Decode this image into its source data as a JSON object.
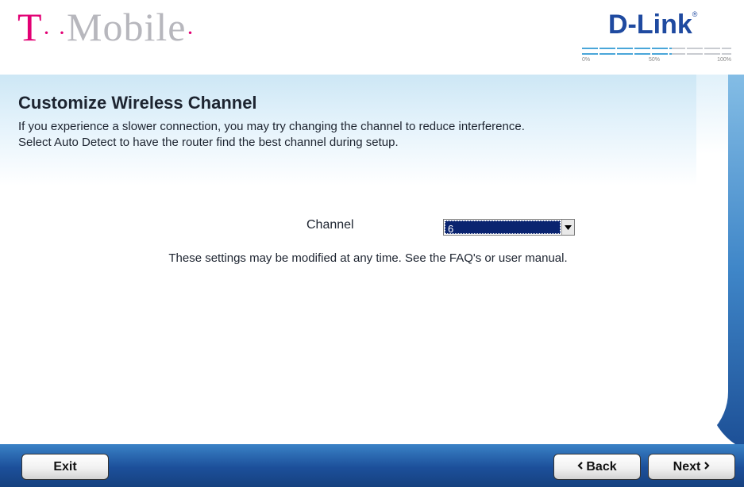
{
  "header": {
    "tmobile_logo": {
      "t": "T",
      "dots": "· ·",
      "mobile": "Mobile",
      "tail": "·"
    },
    "dlink_logo": "D-Link",
    "dlink_mark": "®",
    "progress": {
      "value": 0.6,
      "labels": [
        "0%",
        "50%",
        "100%"
      ]
    }
  },
  "main": {
    "title": "Customize Wireless Channel",
    "description_line1": "If you experience a slower connection, you may try changing the channel to reduce interference.",
    "description_line2": "Select Auto Detect to have the router find the best channel during setup.",
    "channel": {
      "label": "Channel",
      "selected_value": "6"
    },
    "note": "These settings may be modified at any time. See the FAQ's or user manual."
  },
  "footer": {
    "exit_label": "Exit",
    "back_label": "Back",
    "next_label": "Next"
  },
  "colors": {
    "tmobile_magenta": "#e20074",
    "dlink_blue": "#1f4aa0",
    "footer_blue": "#1c4f9a",
    "select_highlight": "#0a2470"
  },
  "icons": {
    "back": "chevron-left-icon",
    "next": "chevron-right-icon",
    "dropdown": "chevron-down-icon"
  }
}
